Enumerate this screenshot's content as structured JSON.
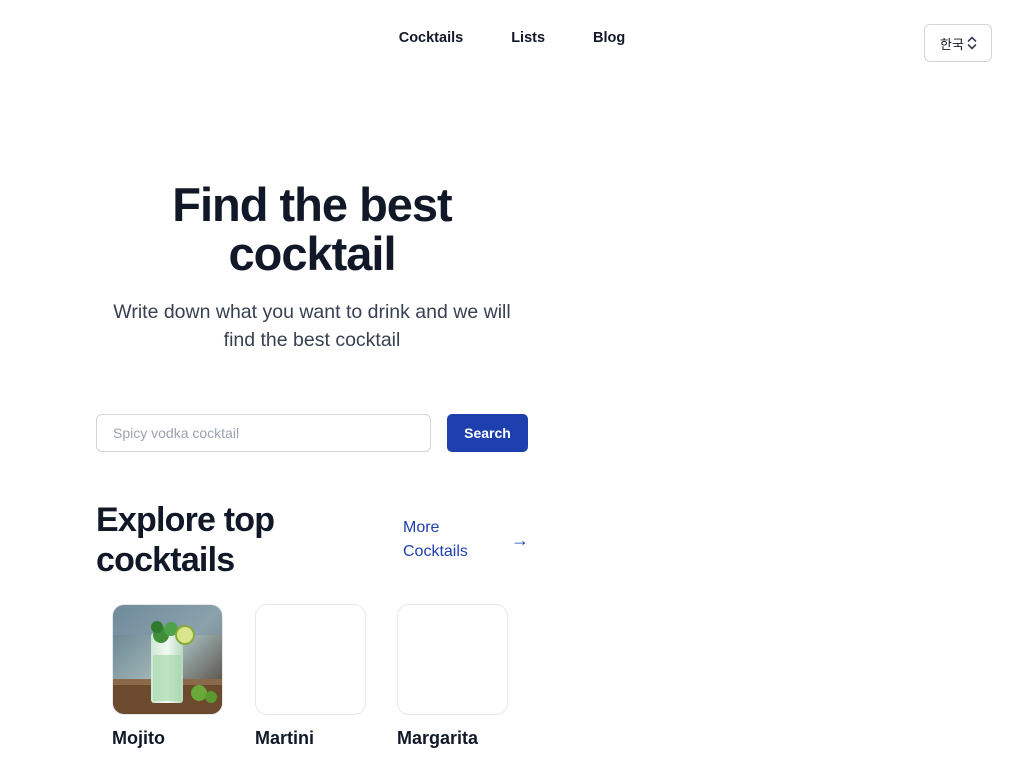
{
  "nav": {
    "items": [
      {
        "label": "Cocktails"
      },
      {
        "label": "Lists"
      },
      {
        "label": "Blog"
      }
    ]
  },
  "language_select": {
    "value": "한국",
    "icon": "chevron-up-down-icon"
  },
  "hero": {
    "title": "Find the best cocktail",
    "subtitle": "Write down what you want to drink and we will find the best cocktail"
  },
  "search": {
    "placeholder": "Spicy vodka cocktail",
    "value": "",
    "button_label": "Search"
  },
  "explore": {
    "title": "Explore top cocktails",
    "more_label": "More Cocktails",
    "more_icon": "arrow-right-icon",
    "cards": [
      {
        "name": "Mojito",
        "has_image": true
      },
      {
        "name": "Martini",
        "has_image": false
      },
      {
        "name": "Margarita",
        "has_image": false
      }
    ]
  },
  "colors": {
    "accent": "#1e40af",
    "text": "#111827",
    "border": "#d1d5db"
  }
}
